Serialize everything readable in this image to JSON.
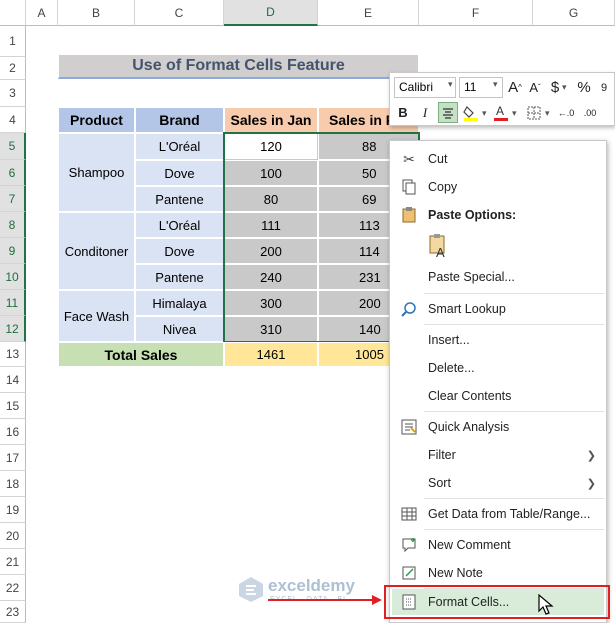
{
  "columns": [
    "A",
    "B",
    "C",
    "D",
    "E",
    "F",
    "G"
  ],
  "rows": [
    "1",
    "2",
    "3",
    "4",
    "5",
    "6",
    "7",
    "8",
    "9",
    "10",
    "11",
    "12",
    "13",
    "14",
    "15",
    "16",
    "17",
    "18",
    "19",
    "20",
    "21",
    "22",
    "23"
  ],
  "title": "Use of Format Cells Feature",
  "table": {
    "headers": [
      "Product",
      "Brand",
      "Sales in Jan",
      "Sales in F"
    ],
    "products": [
      "Shampoo",
      "Conditoner",
      "Face Wash"
    ],
    "brands": [
      "L'Oréal",
      "Dove",
      "Pantene",
      "L'Oréal",
      "Dove",
      "Pantene",
      "Himalaya",
      "Nivea"
    ],
    "jan": [
      "120",
      "100",
      "80",
      "111",
      "200",
      "240",
      "300",
      "310"
    ],
    "feb": [
      "88",
      "50",
      "69",
      "113",
      "114",
      "231",
      "200",
      "140"
    ],
    "total_label": "Total Sales",
    "total_jan": "1461",
    "total_feb": "1005"
  },
  "mini_toolbar": {
    "font": "Calibri",
    "size": "11",
    "grow": "A^",
    "shrink": "A˅",
    "currency": "$",
    "percent": "%",
    "bold": "B",
    "italic": "I"
  },
  "menu": {
    "cut": "Cut",
    "copy": "Copy",
    "paste_options": "Paste Options:",
    "paste_special": "Paste Special...",
    "smart_lookup": "Smart Lookup",
    "insert": "Insert...",
    "delete": "Delete...",
    "clear_contents": "Clear Contents",
    "quick_analysis": "Quick Analysis",
    "filter": "Filter",
    "sort": "Sort",
    "get_data": "Get Data from Table/Range...",
    "new_comment": "New Comment",
    "new_note": "New Note",
    "format_cells": "Format Cells..."
  },
  "watermark": {
    "name": "exceldemy",
    "tagline": "EXCEL · DATA · BI"
  },
  "colors": {
    "highlight_box": "#e02020",
    "selected": "#217346"
  }
}
